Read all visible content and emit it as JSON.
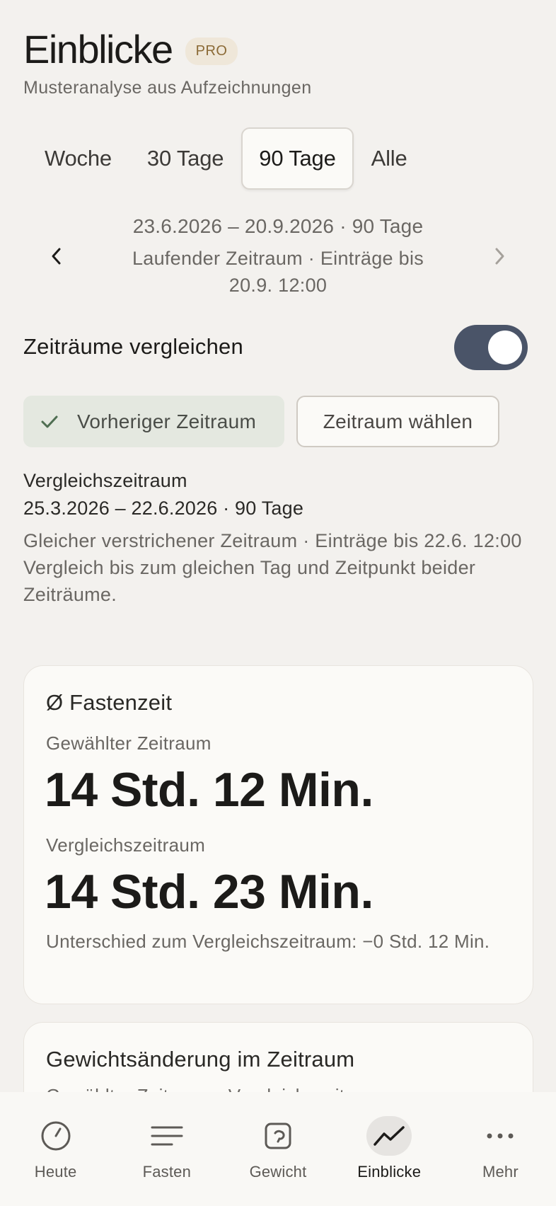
{
  "header": {
    "title": "Einblicke",
    "badge": "PRO",
    "subtitle": "Musteranalyse aus Aufzeichnungen"
  },
  "period_tabs": [
    {
      "label": "Woche",
      "active": false
    },
    {
      "label": "30 Tage",
      "active": false
    },
    {
      "label": "90 Tage",
      "active": true
    },
    {
      "label": "Alle",
      "active": false
    }
  ],
  "date_nav": {
    "range": "23.6.2026 – 20.9.2026 · 90 Tage",
    "status_line1": "Laufender Zeitraum · Einträge bis",
    "status_line2": "20.9. 12:00"
  },
  "compare": {
    "label": "Zeiträume vergleichen",
    "enabled": true,
    "chip_previous": "Vorheriger Zeitraum",
    "chip_choose": "Zeitraum wählen",
    "comparison_label": "Vergleichszeitraum",
    "comparison_range": "25.3.2026 – 22.6.2026 · 90 Tage",
    "note_line1": "Gleicher verstrichener Zeitraum · Einträge bis 22.6. 12:00",
    "note_line2": "Vergleich bis zum gleichen Tag und Zeitpunkt beider Zeiträume."
  },
  "fasting_card": {
    "title": "Ø Fastenzeit",
    "selected_label": "Gewählter Zeitraum",
    "selected_value": "14 Std. 12 Min.",
    "comparison_label": "Vergleichszeitraum",
    "comparison_value": "14 Std. 23 Min.",
    "difference": "Unterschied zum Vergleichszeitraum: −0 Std. 12 Min."
  },
  "weight_card": {
    "title": "Gewichtsänderung im Zeitraum",
    "sub": "Gewählter Zeitraum · Vergleichszeitraum"
  },
  "bottom_nav": [
    {
      "label": "Heute",
      "icon": "clock-icon",
      "active": false
    },
    {
      "label": "Fasten",
      "icon": "lines-icon",
      "active": false
    },
    {
      "label": "Gewicht",
      "icon": "scale-icon",
      "active": false
    },
    {
      "label": "Einblicke",
      "icon": "trend-icon",
      "active": true
    },
    {
      "label": "Mehr",
      "icon": "more-icon",
      "active": false
    }
  ],
  "colors": {
    "background": "#f3f1ee",
    "toggle_on": "#4a5468",
    "chip_selected": "#e4e8e0",
    "check": "#4f6e52",
    "badge_bg": "#efe7d9",
    "badge_text": "#8b6a36"
  }
}
